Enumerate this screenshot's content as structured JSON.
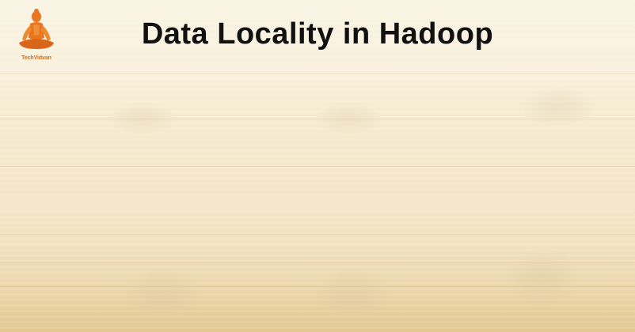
{
  "slide": {
    "title": "Data Locality in Hadoop"
  },
  "logo": {
    "text": "TechVidvan",
    "icon": "meditating-figure-logo-icon",
    "color": "#e8761e"
  },
  "colors": {
    "title": "#111111",
    "background_top": "#faf4e4",
    "background_bottom": "#e3c791"
  }
}
